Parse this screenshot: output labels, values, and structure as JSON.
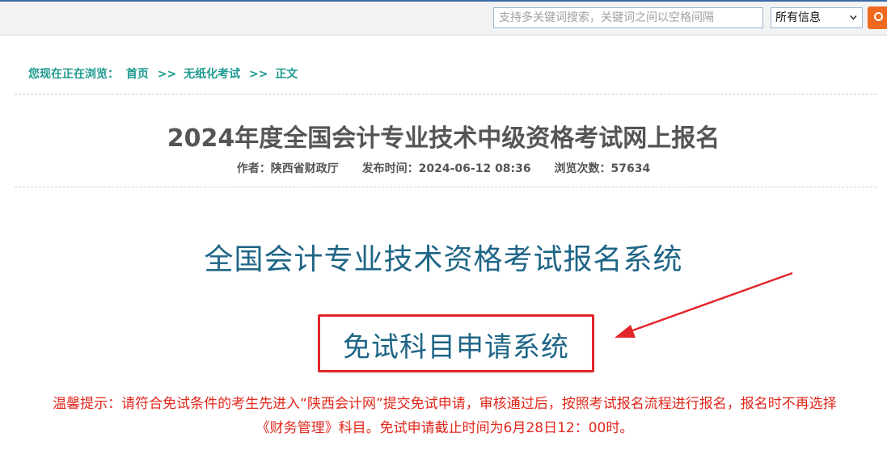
{
  "search": {
    "placeholder": "支持多关键词搜索，关键词之间以空格间隔",
    "scope_selected": "所有信息",
    "button_color": "#ef6a1e"
  },
  "breadcrumb": {
    "prefix": "您现在正在浏览：",
    "items": [
      "首页",
      "无纸化考试",
      "正文"
    ],
    "separator": ">>"
  },
  "article": {
    "title": "2024年度全国会计专业技术中级资格考试网上报名",
    "author_label": "作者：",
    "author": "陕西省财政厅",
    "time_label": "发布时间：",
    "time": "2024-06-12 08:36",
    "views_label": "浏览次数：",
    "views": "57634"
  },
  "content": {
    "system_title": "全国会计专业技术资格考试报名系统",
    "exempt_link": "免试科目申请系统",
    "notice_line1": "温馨提示：请符合免试条件的考生先进入“陕西会计网”提交免试申请，审核通过后，按照考试报名流程进行报名，报名时不再选择",
    "notice_line2": "《财务管理》科目。免试申请截止时间为6月28日12：00时。"
  },
  "colors": {
    "breadcrumb": "#1c9a8e",
    "system_title": "#1e6586",
    "highlight_box": "#e2262a",
    "notice": "#e1271c"
  },
  "icons": [
    "chevron-down-icon",
    "search-icon",
    "red-arrow-annotation"
  ]
}
